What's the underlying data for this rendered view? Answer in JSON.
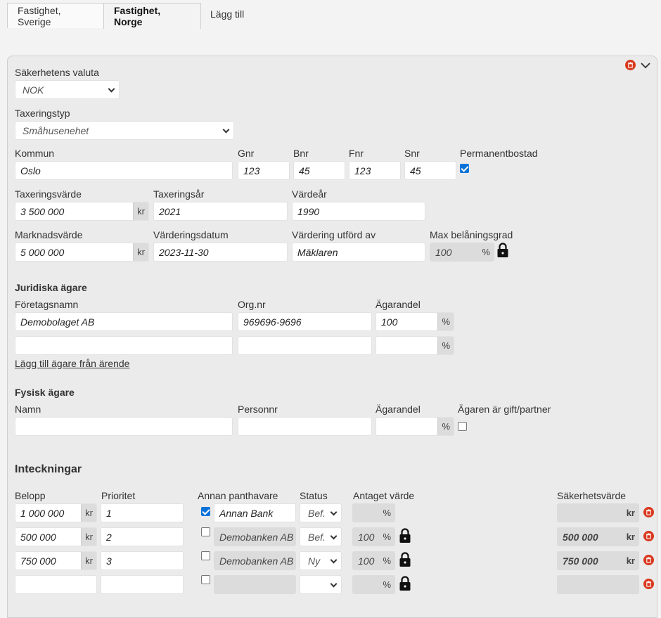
{
  "tabs": [
    {
      "label": "Fastighet, Sverige"
    },
    {
      "label": "Fastighet, Norge"
    },
    {
      "label": "Lägg till"
    }
  ],
  "currency": {
    "label": "Säkerhetens valuta",
    "value": "NOK"
  },
  "tax_type": {
    "label": "Taxeringstyp",
    "value": "Småhusenehet"
  },
  "location": {
    "kommun_label": "Kommun",
    "kommun": "Oslo",
    "gnr_label": "Gnr",
    "gnr": "123",
    "bnr_label": "Bnr",
    "bnr": "45",
    "fnr_label": "Fnr",
    "fnr": "123",
    "snr_label": "Snr",
    "snr": "45",
    "permanent_label": "Permanentbostad",
    "permanent_checked": true
  },
  "taxation": {
    "value_label": "Taxeringsvärde",
    "value": "3 500 000",
    "unit": "kr",
    "year_label": "Taxeringsår",
    "year": "2021",
    "value_year_label": "Värdeår",
    "value_year": "1990"
  },
  "market": {
    "value_label": "Marknadsvärde",
    "value": "5 000 000",
    "unit": "kr",
    "date_label": "Värderingsdatum",
    "date": "2023-11-30",
    "by_label": "Värdering utförd av",
    "by": "Mäklaren",
    "ltv_label": "Max belåningsgrad",
    "ltv": "100",
    "ltv_unit": "%"
  },
  "legal_owners": {
    "title": "Juridiska ägare",
    "col_company": "Företagsnamn",
    "col_org": "Org.nr",
    "col_share": "Ägarandel",
    "share_unit": "%",
    "rows": [
      {
        "company": "Demobolaget AB",
        "org": "969696-9696",
        "share": "100"
      },
      {
        "company": "",
        "org": "",
        "share": ""
      }
    ],
    "add_link": "Lägg till ägare från ärende"
  },
  "physical_owner": {
    "title": "Fysisk ägare",
    "col_name": "Namn",
    "col_pnr": "Personnr",
    "col_share": "Ägarandel",
    "col_married": "Ägaren är gift/partner",
    "share_unit": "%",
    "name": "",
    "pnr": "",
    "share": "",
    "married": false
  },
  "mortgages": {
    "title": "Inteckningar",
    "col_amount": "Belopp",
    "col_priority": "Prioritet",
    "col_holder": "Annan panthavare",
    "col_status": "Status",
    "col_assumed": "Antaget värde",
    "col_security": "Säkerhetsvärde",
    "unit": "kr",
    "pct": "%",
    "rows": [
      {
        "amount": "1 000 000",
        "priority": "1",
        "other": true,
        "holder": "Annan Bank",
        "status": "Bef.",
        "assumed": "",
        "security": "",
        "locked": false
      },
      {
        "amount": "500 000",
        "priority": "2",
        "other": false,
        "holder": "Demobanken AB",
        "status": "Bef.",
        "assumed": "100",
        "security": "500 000",
        "locked": true
      },
      {
        "amount": "750 000",
        "priority": "3",
        "other": false,
        "holder": "Demobanken AB",
        "status": "Ny",
        "assumed": "100",
        "security": "750 000",
        "locked": true
      },
      {
        "amount": "",
        "priority": "",
        "other": false,
        "holder": "",
        "status": "",
        "assumed": "",
        "security": "",
        "locked": true
      }
    ]
  },
  "colors": {
    "accent": "#0a73d9",
    "danger": "#d9381e",
    "panel": "#ebebeb"
  }
}
